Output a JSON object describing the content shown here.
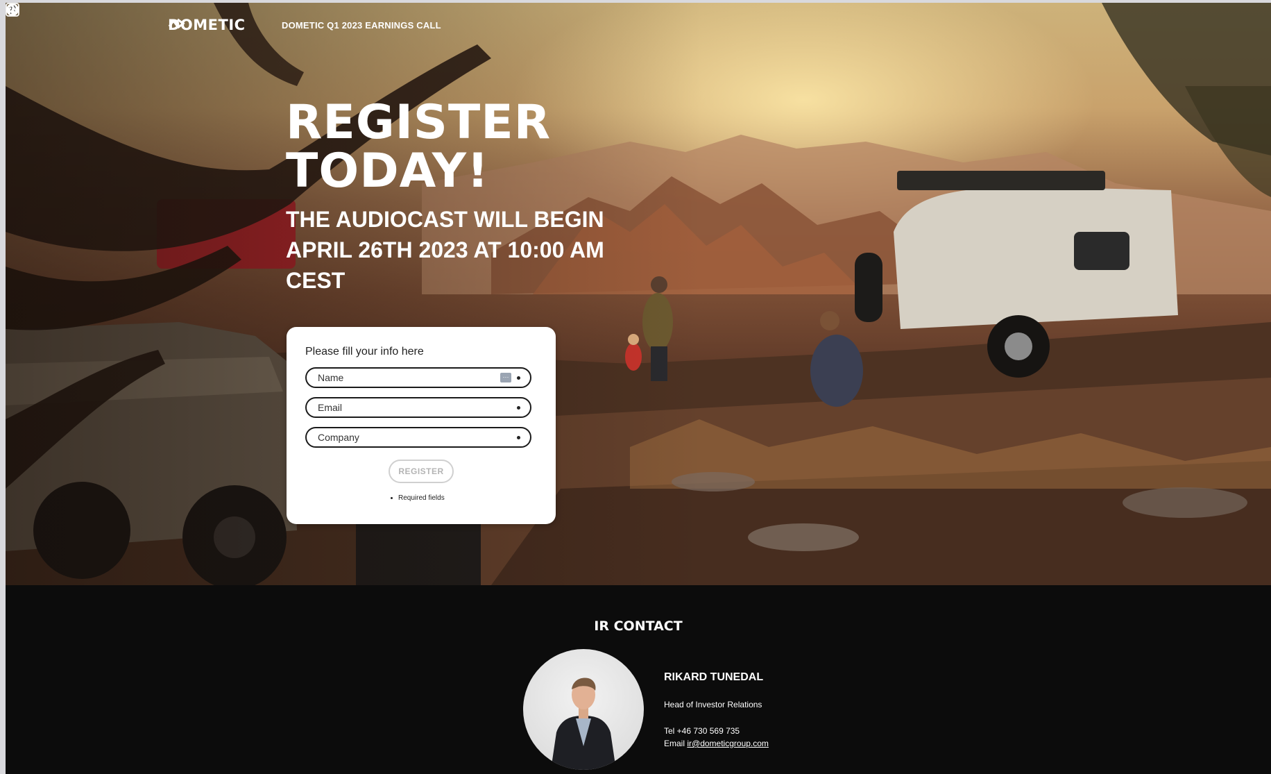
{
  "header": {
    "brand": "DOMETIC",
    "event_title": "DOMETIC Q1 2023 EARNINGS CALL",
    "icons": [
      "globe-icon",
      "linkedin-icon"
    ]
  },
  "hero": {
    "headline_line1": "REGISTER",
    "headline_line2": "TODAY!",
    "subheadline": "THE AUDIOCAST WILL BEGIN APRIL 26TH 2023 AT 10:00 AM CEST"
  },
  "form": {
    "heading": "Please fill your info here",
    "fields": [
      {
        "placeholder": "Name",
        "value": "",
        "required": true
      },
      {
        "placeholder": "Email",
        "value": "",
        "required": true
      },
      {
        "placeholder": "Company",
        "value": "",
        "required": true
      }
    ],
    "submit_label": "REGISTER",
    "required_note": "Required fields"
  },
  "footer": {
    "title": "IR CONTACT",
    "contact": {
      "name": "RIKARD TUNEDAL",
      "role": "Head of Investor Relations",
      "tel": "Tel +46 730 569 735",
      "email_prefix": "Email",
      "email": "ir@dometicgroup.com"
    }
  },
  "colors": {
    "footer_bg": "#0c0c0c",
    "card_bg": "#ffffff",
    "text_on_dark": "#ffffff"
  }
}
